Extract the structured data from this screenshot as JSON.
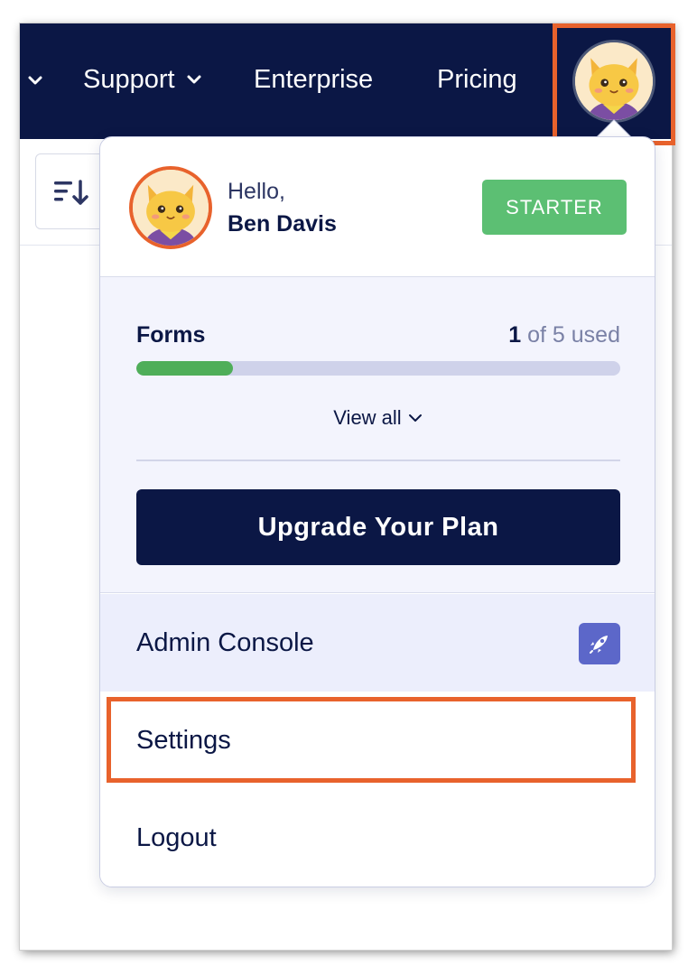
{
  "nav": {
    "items": [
      {
        "label": "Support",
        "has_chevron": true
      },
      {
        "label": "Enterprise",
        "has_chevron": false
      },
      {
        "label": "Pricing",
        "has_chevron": false
      }
    ],
    "leading_chevron_icon": "chevron-down-icon",
    "avatar_icon": "cat-avatar-icon"
  },
  "toolbar": {
    "sort_icon": "sort-descending-icon"
  },
  "user_menu": {
    "greeting": "Hello,",
    "user_name": "Ben Davis",
    "plan_badge": "STARTER",
    "usage": {
      "label": "Forms",
      "used_count": "1",
      "used_suffix": " of 5 used",
      "used": 1,
      "limit": 5
    },
    "view_all_label": "View all",
    "upgrade_label": "Upgrade Your Plan",
    "items": [
      {
        "label": "Admin Console",
        "icon": "rocket-icon"
      },
      {
        "label": "Settings"
      },
      {
        "label": "Logout"
      }
    ]
  },
  "colors": {
    "nav_background": "#0b1745",
    "accent_green": "#5cbf73",
    "progress_fill": "#4fae59",
    "highlight": "#e8622c",
    "admin_icon_bg": "#5c67c9"
  }
}
